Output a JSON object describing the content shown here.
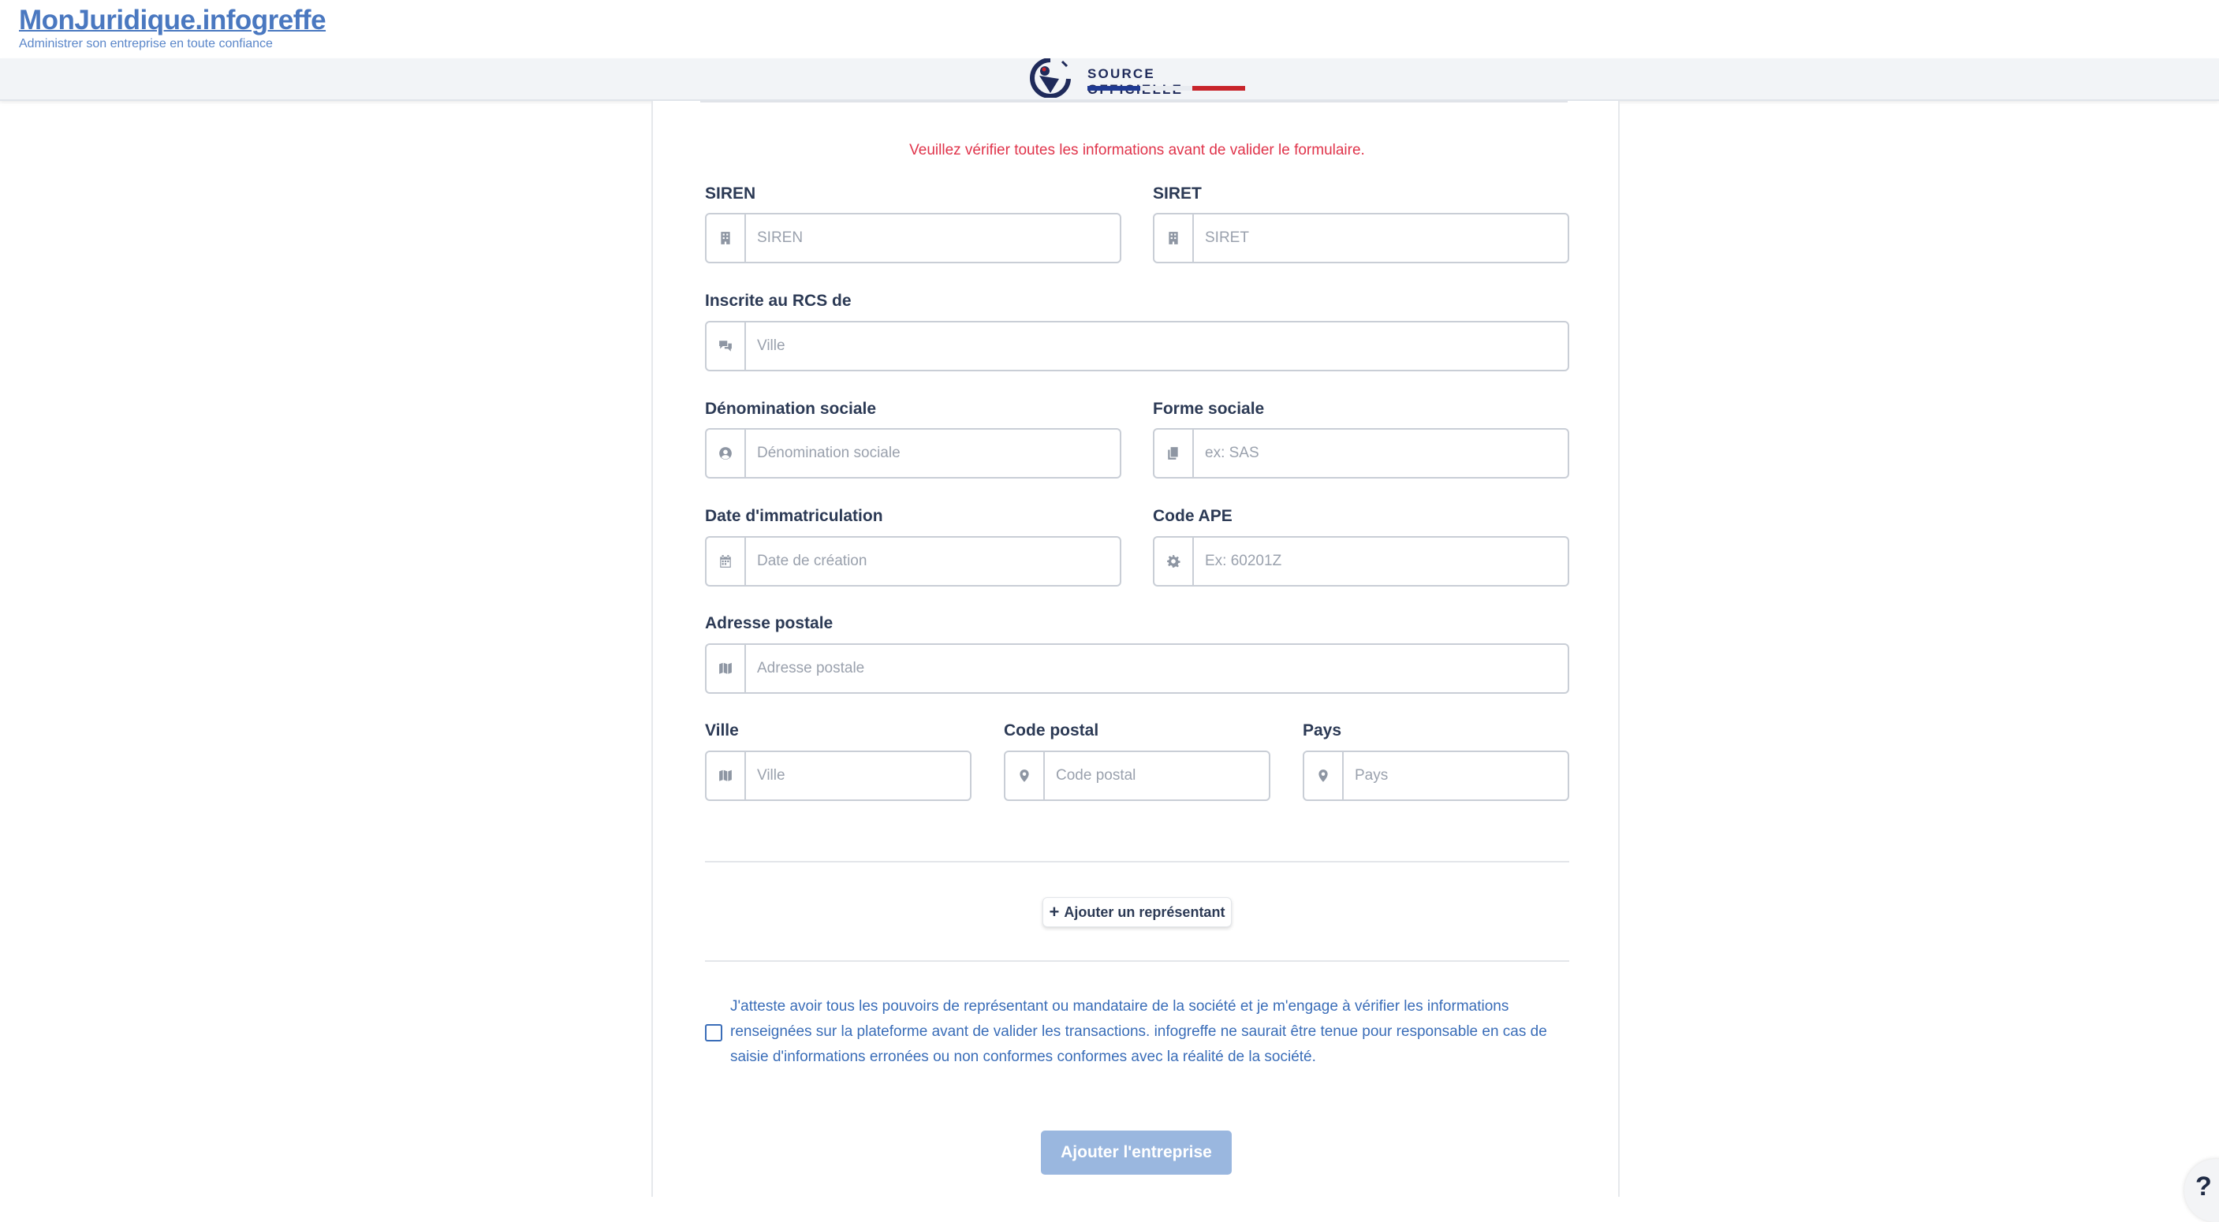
{
  "header": {
    "logo_title": "MonJuridique.infogreffe",
    "logo_subtitle": "Administrer son entreprise en toute confiance",
    "source_label": "SOURCE OFFICIELLE"
  },
  "form": {
    "warning": "Veuillez vérifier toutes les informations avant de valider le formulaire.",
    "siren": {
      "label": "SIREN",
      "placeholder": "SIREN",
      "icon": "building-icon"
    },
    "siret": {
      "label": "SIRET",
      "placeholder": "SIRET",
      "icon": "building-icon"
    },
    "rcs": {
      "label": "Inscrite au RCS de",
      "placeholder": "Ville",
      "icon": "comments-icon"
    },
    "denomination": {
      "label": "Dénomination sociale",
      "placeholder": "Dénomination sociale",
      "icon": "user-circle-icon"
    },
    "forme": {
      "label": "Forme sociale",
      "placeholder": "ex: SAS",
      "icon": "copy-icon"
    },
    "date": {
      "label": "Date d'immatriculation",
      "placeholder": "Date de création",
      "icon": "calendar-icon"
    },
    "ape": {
      "label": "Code APE",
      "placeholder": "Ex: 60201Z",
      "icon": "gear-icon"
    },
    "adresse": {
      "label": "Adresse postale",
      "placeholder": "Adresse postale",
      "icon": "map-icon"
    },
    "ville": {
      "label": "Ville",
      "placeholder": "Ville",
      "icon": "map-icon"
    },
    "code_postal": {
      "label": "Code postal",
      "placeholder": "Code postal",
      "icon": "map-marker-icon"
    },
    "pays": {
      "label": "Pays",
      "placeholder": "Pays",
      "icon": "map-marker-icon"
    },
    "add_representative": "Ajouter un représentant",
    "attestation": "J'atteste avoir tous les pouvoirs de représentant ou mandataire de la société et je m'engage à vérifier les informations renseignées sur la plateforme avant de valider les transactions. infogreffe ne saurait être tenue pour responsable en cas de saisie d'informations erronées ou non conformes conformes avec la réalité de la société.",
    "submit": "Ajouter l'entreprise"
  },
  "help": {
    "label": "?"
  },
  "colors": {
    "accent": "#3a6db8",
    "warning": "#e0344b",
    "submit_disabled": "#9ab7df",
    "flag_blue": "#1f3a93",
    "flag_red": "#c8242b"
  }
}
